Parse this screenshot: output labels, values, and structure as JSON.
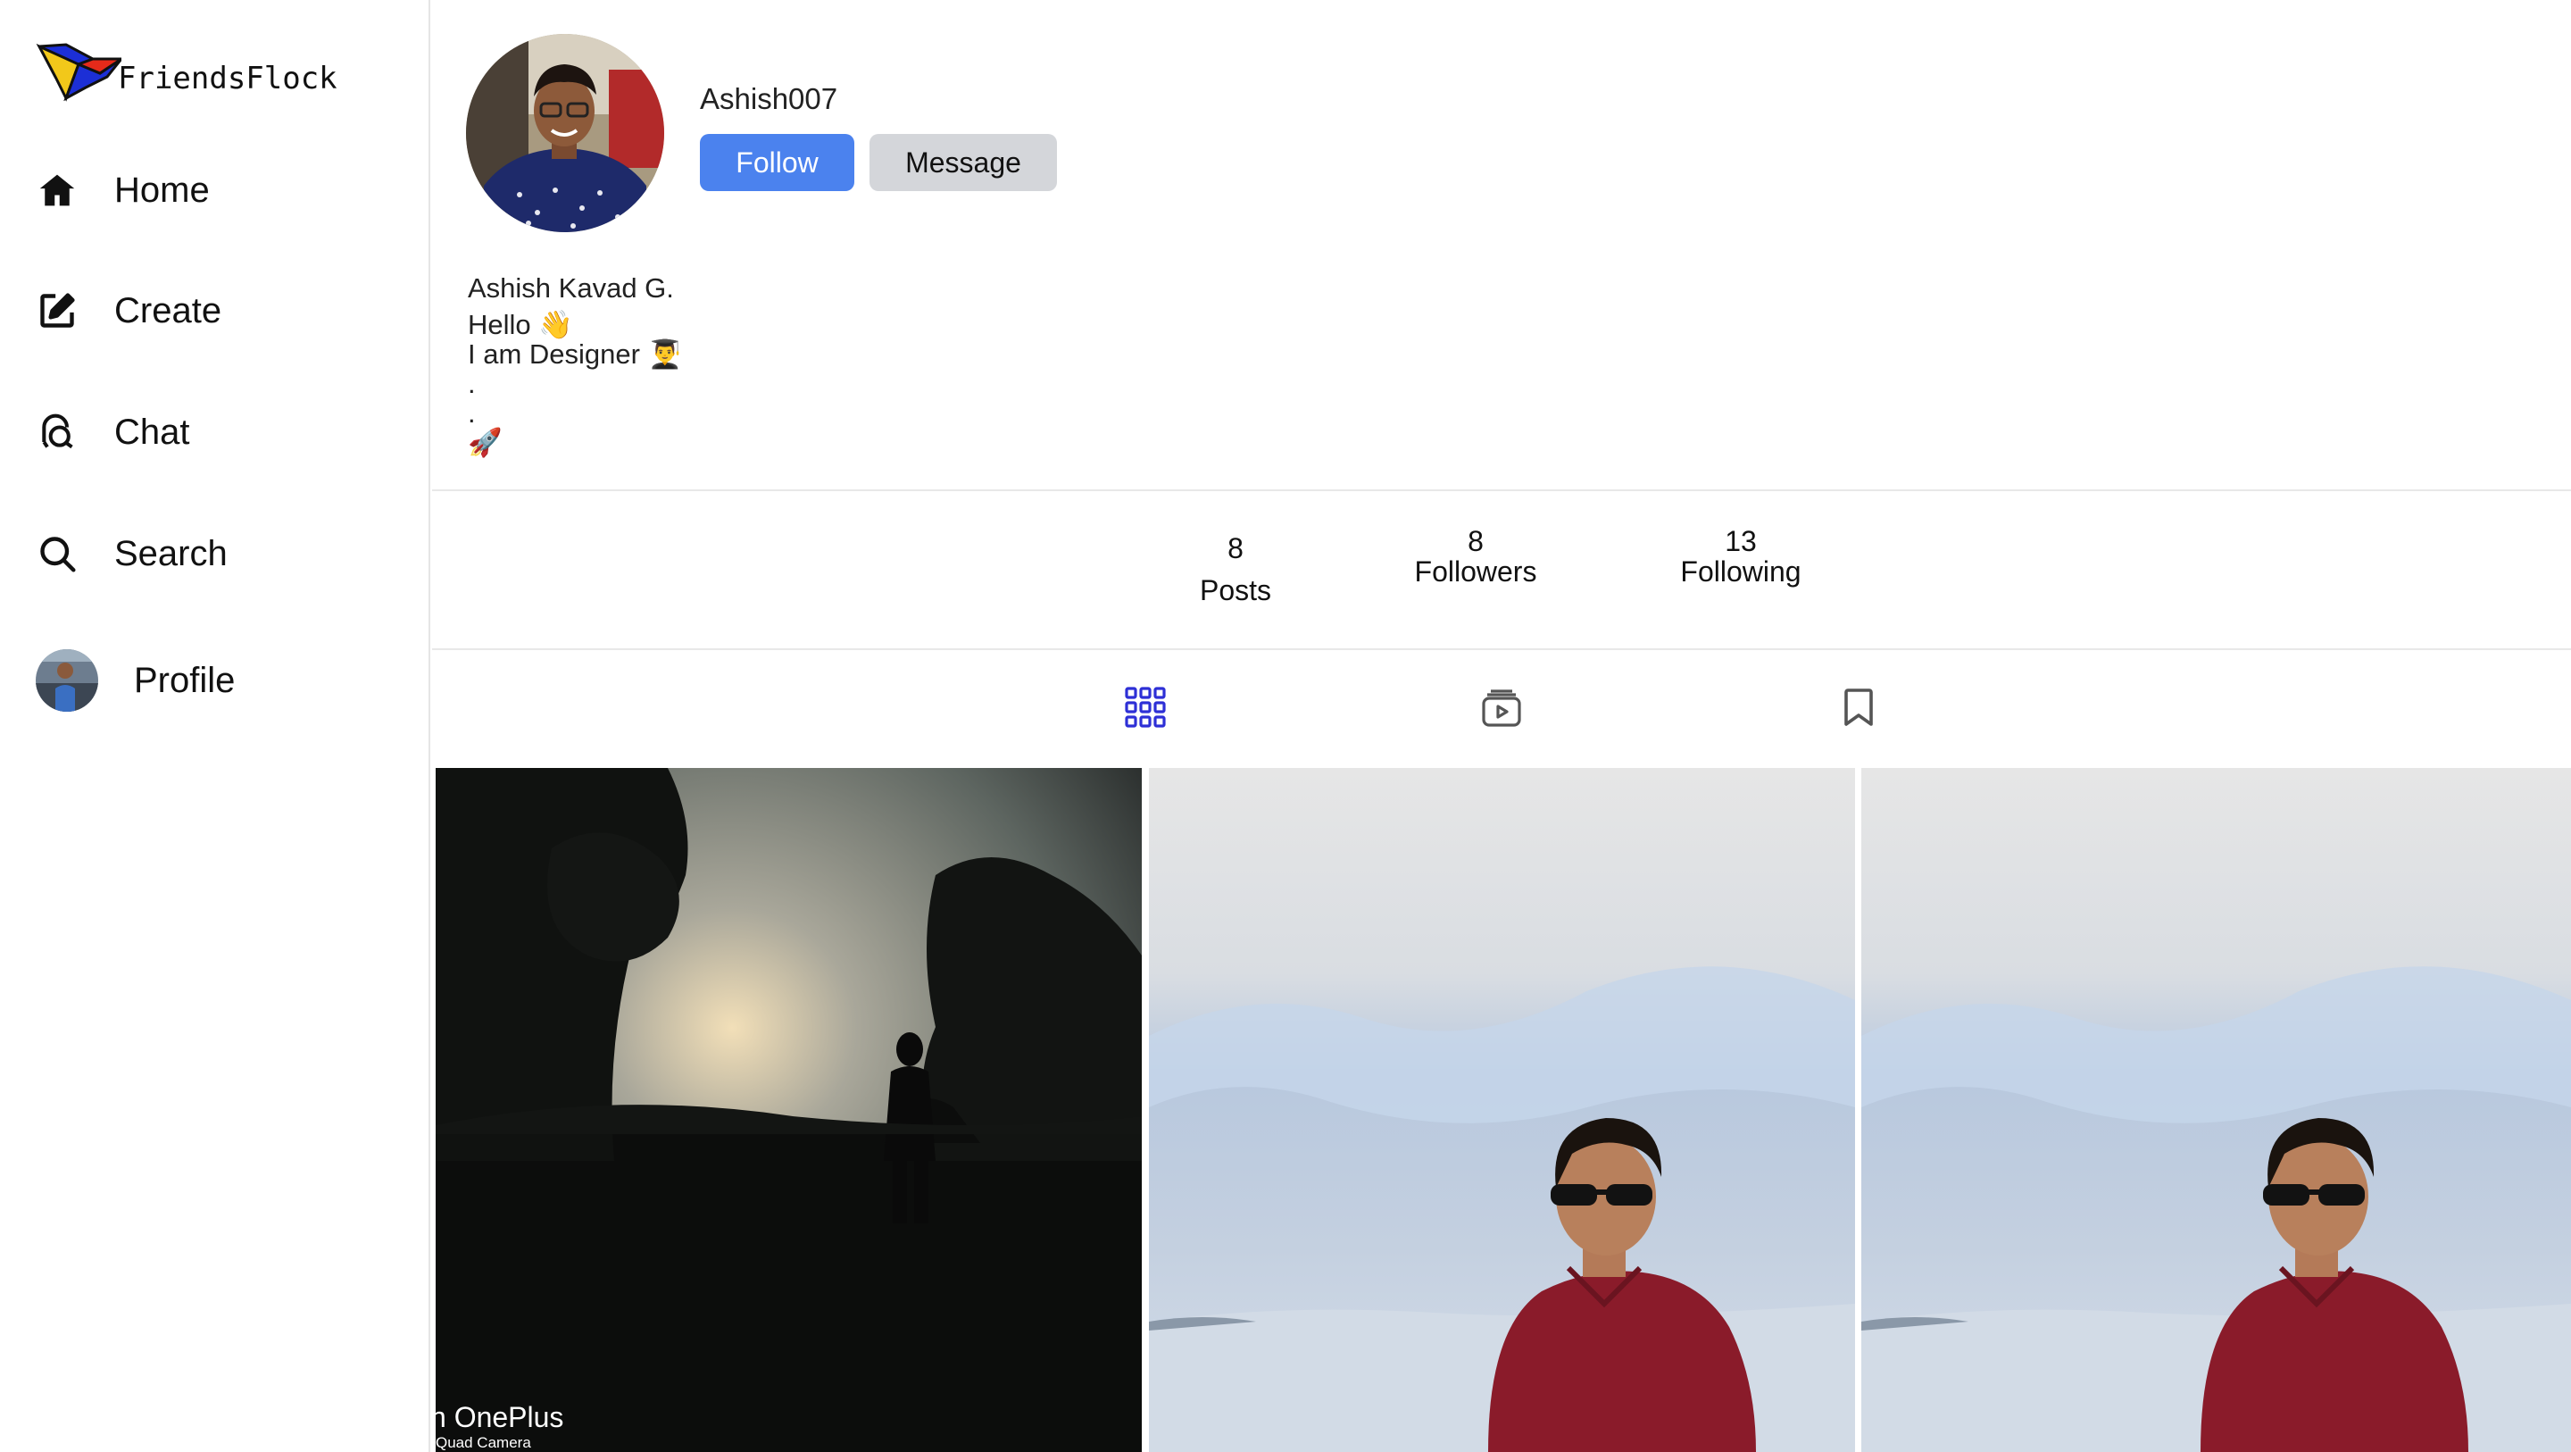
{
  "app": {
    "name": "FriendsFlock"
  },
  "sidebar": {
    "items": [
      {
        "label": "Home",
        "icon": "home-icon"
      },
      {
        "label": "Create",
        "icon": "edit-icon"
      },
      {
        "label": "Chat",
        "icon": "chat-icon"
      },
      {
        "label": "Search",
        "icon": "search-icon"
      },
      {
        "label": "Profile",
        "icon": "avatar"
      }
    ]
  },
  "profile": {
    "username": "Ashish007",
    "follow_label": "Follow",
    "message_label": "Message",
    "bio": {
      "name": "Ashish Kavad G.",
      "line1": "Hello 👋",
      "line2": "I am Designer 👨‍🎓",
      "line3": ".",
      "line4": ".",
      "line5": "🚀"
    }
  },
  "stats": {
    "posts": {
      "count": "8",
      "label": "Posts"
    },
    "followers": {
      "count": "8",
      "label": "Followers"
    },
    "following": {
      "count": "13",
      "label": "Following"
    }
  },
  "tabs": [
    {
      "name": "posts",
      "icon": "grid-icon",
      "active": true
    },
    {
      "name": "reels",
      "icon": "reels-icon",
      "active": false
    },
    {
      "name": "saved",
      "icon": "bookmark-icon",
      "active": false
    }
  ],
  "posts": [
    {
      "watermark_main": "n OnePlus",
      "watermark_sub": "Quad Camera"
    },
    {
      "description": "portrait-red-shirt"
    },
    {
      "description": "portrait-red-shirt"
    }
  ],
  "colors": {
    "accent": "#4b82ee",
    "message_button": "#d4d6da",
    "active_tab": "#2d2fd6",
    "divider": "#e8e8e8"
  }
}
